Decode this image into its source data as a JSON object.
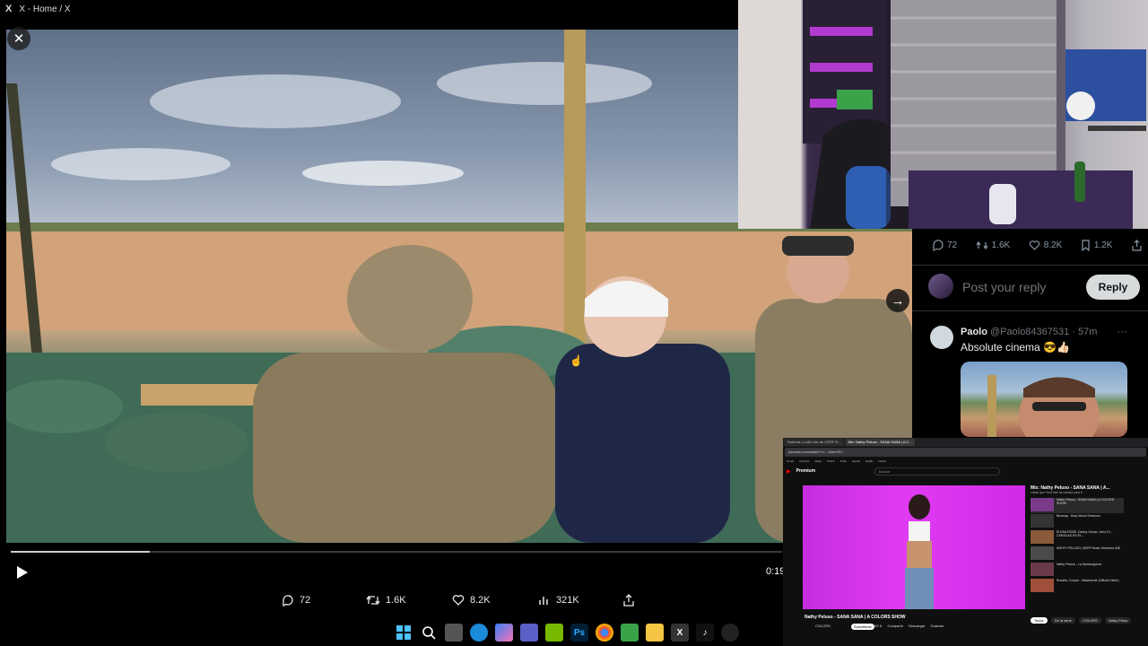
{
  "window": {
    "app_icon": "x-logo",
    "title": "X - Home / X"
  },
  "video": {
    "close_label": "✕",
    "next_label": "→",
    "progress_fraction": 0.18,
    "time": "0:19",
    "play_icon": "play-icon"
  },
  "actions": {
    "reply_count": "72",
    "repost_count": "1.6K",
    "like_count": "8.2K",
    "view_count": "321K"
  },
  "side_panel": {
    "stats": {
      "reply": "72",
      "repost": "1.6K",
      "like": "8.2K",
      "bookmark": "1.2K"
    },
    "reply_placeholder": "Post your reply",
    "reply_button": "Reply",
    "comment": {
      "name": "Paolo",
      "handle": "@Paolo84367531 · 57m",
      "text": "Absolute cinema 😎👍🏻",
      "more": "···"
    }
  },
  "browser": {
    "tabs": [
      "Roberta Lo Mio Mix de CERF R...",
      "Mix: Nathy Peluso - SANA SANA | A C..."
    ],
    "url": "youtube.com/watch?v=...&list=RD...",
    "bookmarks": [
      "Gmail",
      "YouTube",
      "Maps",
      "Twitch",
      "Trello",
      "Spotify",
      "Netflix",
      "Notion"
    ],
    "logo": "Premium",
    "search_placeholder": "Buscar",
    "video_title": "Nathy Peluso - SANA SANA | A COLORS SHOW",
    "channel": "COLORS",
    "subscribe": "Suscribirse",
    "video_actions": [
      "582 K",
      "Compartir",
      "Descargar",
      "Guardar"
    ],
    "playlist_title": "Mix: Nathy Peluso - SANA SANA | A...",
    "playlist_sub": "Listas que YouTube ha creado para ti",
    "playlist_items": [
      "Nathy Peluso - SANA SANA | A COLORS SHOW",
      "Bizarrap - Bzrp Music Sessions",
      "ELENA ROSE, Danny Ocean, Jerry Di - CARACAS EN EL...",
      "NATHY PELUSO | BZRP Music Sessions #36",
      "Nathy Peluso - La Sandunguera",
      "Rosalía, Cooper - Malamente (Official Video)"
    ],
    "chips": [
      "Todos",
      "De la serie",
      "COLORS",
      "Nathy Pelus"
    ]
  },
  "taskbar": {
    "icons": [
      "windows-icon",
      "search-icon",
      "task-view-icon",
      "edge-icon",
      "copilot-icon",
      "teams-icon",
      "nvidia-icon",
      "photoshop-icon",
      "chrome-icon",
      "minecraft-icon",
      "files-icon",
      "x-icon",
      "tiktok-icon",
      "obs-icon"
    ],
    "ps_label": "Ps",
    "x_label": "X"
  }
}
